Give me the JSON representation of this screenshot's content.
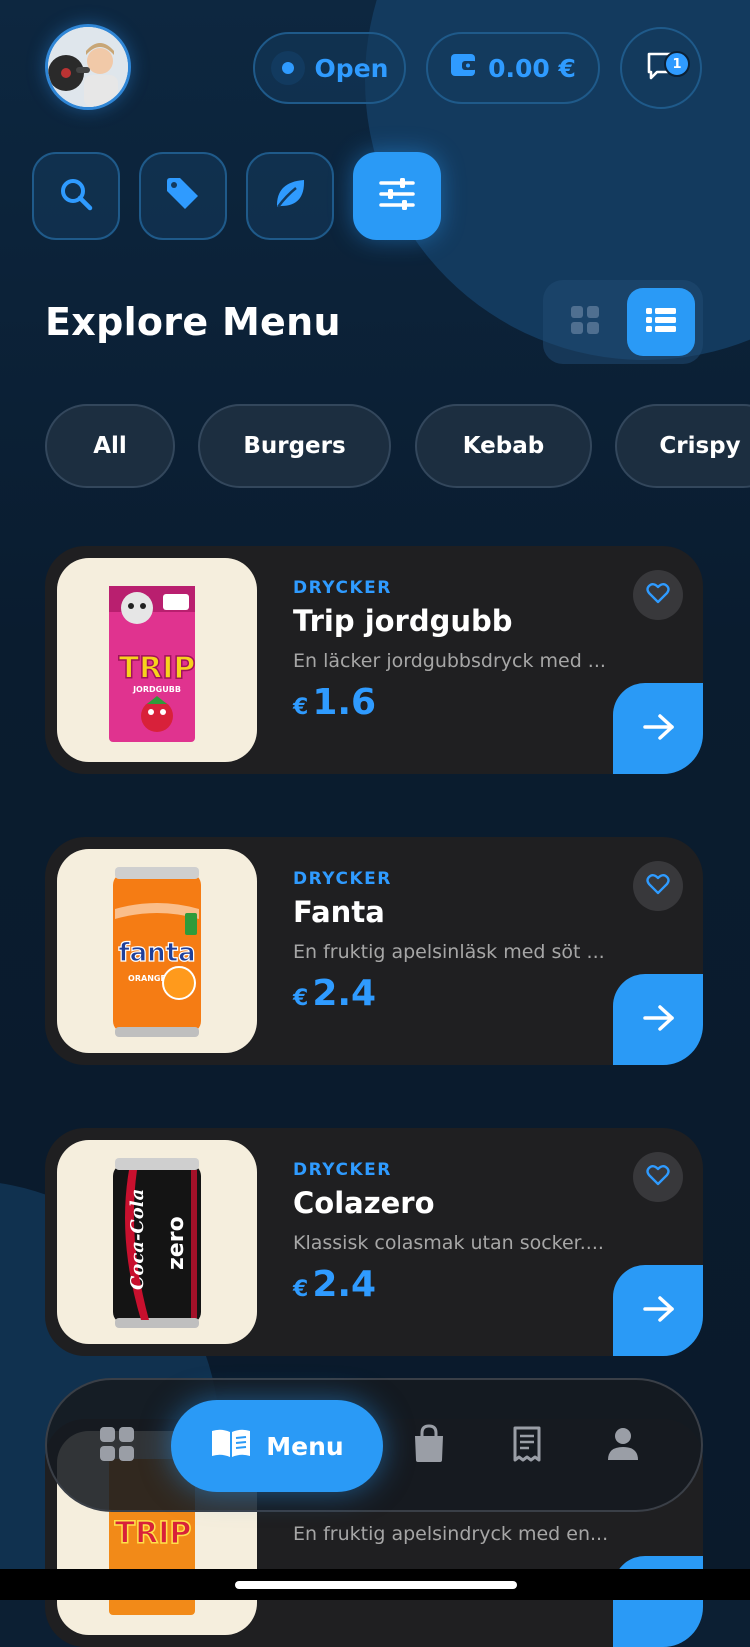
{
  "header": {
    "status_label": "Open",
    "wallet_amount": "0.00 €",
    "chat_badge_count": "1",
    "colors": {
      "accent": "#2a9af6",
      "card_bg": "#1f1f21",
      "bg": "#0c1f33"
    }
  },
  "filters": {
    "icons": [
      "search-icon",
      "tag-icon",
      "leaf-icon",
      "sliders-icon"
    ],
    "active": "sliders-icon"
  },
  "page": {
    "title": "Explore Menu",
    "view_mode": "list"
  },
  "categories": [
    "All",
    "Burgers",
    "Kebab",
    "Crispy"
  ],
  "products": [
    {
      "category": "DRYCKER",
      "name": "Trip jordgubb",
      "description": "En läcker jordgubbsdryck med ...",
      "currency": "€",
      "price": "1.6"
    },
    {
      "category": "DRYCKER",
      "name": "Fanta",
      "description": "En fruktig apelsinläsk med söt ...",
      "currency": "€",
      "price": "2.4"
    },
    {
      "category": "DRYCKER",
      "name": "Colazero",
      "description": "Klassisk colasmak utan socker....",
      "currency": "€",
      "price": "2.4"
    },
    {
      "category": "",
      "name": "",
      "description": "En fruktig apelsindryck med en...",
      "currency": "",
      "price": ""
    }
  ],
  "product_images": {
    "p1_box_text": "TRIP",
    "p1_box_sub": "JORDGUBB",
    "p2_can_text": "fanta",
    "p2_can_sub": "ORANGE",
    "p3_can_text": "Coca-Cola",
    "p3_can_sub": "zero",
    "p4_box_text": "TRIP"
  },
  "bottom_nav": {
    "items": [
      "grid-icon",
      "menu-book-icon",
      "shopping-bag-icon",
      "receipt-icon",
      "user-icon"
    ],
    "active_label": "Menu"
  }
}
